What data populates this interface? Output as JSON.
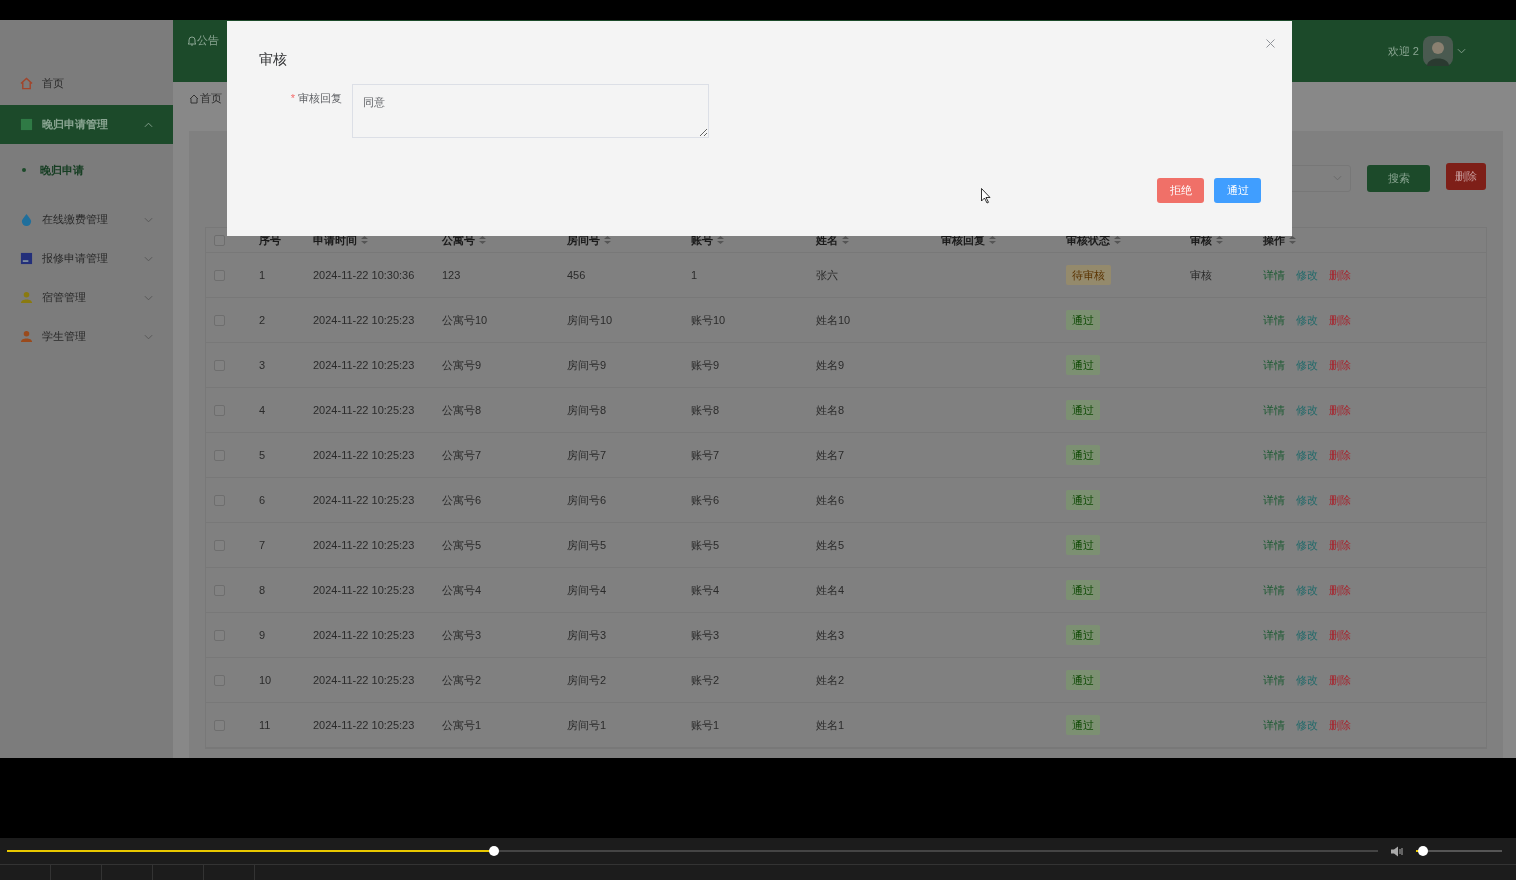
{
  "header": {
    "notice": "公告",
    "welcome": "欢迎 2"
  },
  "sidebar": {
    "items": [
      {
        "label": "首页",
        "kind": "link",
        "selected": false
      },
      {
        "label": "晚归申请管理",
        "kind": "menu",
        "selected": true,
        "expanded": true,
        "children": [
          {
            "label": "晚归申请",
            "selected": true
          }
        ]
      },
      {
        "label": "在线缴费管理",
        "kind": "menu",
        "selected": false,
        "expanded": false
      },
      {
        "label": "报修申请管理",
        "kind": "menu",
        "selected": false,
        "expanded": false
      },
      {
        "label": "宿管管理",
        "kind": "menu",
        "selected": false,
        "expanded": false
      },
      {
        "label": "学生管理",
        "kind": "menu",
        "selected": false,
        "expanded": false
      }
    ]
  },
  "breadcrumb": "首页",
  "toolbar": {
    "search_button": "搜索",
    "delete_button": "删除"
  },
  "table": {
    "all_checked": false,
    "columns": [
      "序号",
      "申请时间",
      "公寓号",
      "房间号",
      "账号",
      "姓名",
      "审核回复",
      "审核状态",
      "审核",
      "操作"
    ],
    "rows": [
      {
        "checked": false,
        "cells": [
          "1",
          "2024-11-22 10:30:36",
          "123",
          "456",
          "1",
          "张六"
        ],
        "status": {
          "label": "待审核",
          "kind": "pending"
        },
        "audit": "审核",
        "actions": [
          {
            "label": "详情",
            "kind": "detail"
          },
          {
            "label": "修改",
            "kind": "edit"
          },
          {
            "label": "删除",
            "kind": "delete"
          }
        ]
      },
      {
        "checked": false,
        "cells": [
          "2",
          "2024-11-22 10:25:23",
          "公寓号10",
          "房间号10",
          "账号10",
          "姓名10"
        ],
        "status": {
          "label": "通过",
          "kind": "passed"
        },
        "actions": [
          {
            "label": "详情",
            "kind": "detail"
          },
          {
            "label": "修改",
            "kind": "edit"
          },
          {
            "label": "删除",
            "kind": "delete"
          }
        ]
      },
      {
        "checked": false,
        "cells": [
          "3",
          "2024-11-22 10:25:23",
          "公寓号9",
          "房间号9",
          "账号9",
          "姓名9"
        ],
        "status": {
          "label": "通过",
          "kind": "passed"
        },
        "actions": [
          {
            "label": "详情",
            "kind": "detail"
          },
          {
            "label": "修改",
            "kind": "edit"
          },
          {
            "label": "删除",
            "kind": "delete"
          }
        ]
      },
      {
        "checked": false,
        "cells": [
          "4",
          "2024-11-22 10:25:23",
          "公寓号8",
          "房间号8",
          "账号8",
          "姓名8"
        ],
        "status": {
          "label": "通过",
          "kind": "passed"
        },
        "actions": [
          {
            "label": "详情",
            "kind": "detail"
          },
          {
            "label": "修改",
            "kind": "edit"
          },
          {
            "label": "删除",
            "kind": "delete"
          }
        ]
      },
      {
        "checked": false,
        "cells": [
          "5",
          "2024-11-22 10:25:23",
          "公寓号7",
          "房间号7",
          "账号7",
          "姓名7"
        ],
        "status": {
          "label": "通过",
          "kind": "passed"
        },
        "actions": [
          {
            "label": "详情",
            "kind": "detail"
          },
          {
            "label": "修改",
            "kind": "edit"
          },
          {
            "label": "删除",
            "kind": "delete"
          }
        ]
      },
      {
        "checked": false,
        "cells": [
          "6",
          "2024-11-22 10:25:23",
          "公寓号6",
          "房间号6",
          "账号6",
          "姓名6"
        ],
        "status": {
          "label": "通过",
          "kind": "passed"
        },
        "actions": [
          {
            "label": "详情",
            "kind": "detail"
          },
          {
            "label": "修改",
            "kind": "edit"
          },
          {
            "label": "删除",
            "kind": "delete"
          }
        ]
      },
      {
        "checked": false,
        "cells": [
          "7",
          "2024-11-22 10:25:23",
          "公寓号5",
          "房间号5",
          "账号5",
          "姓名5"
        ],
        "status": {
          "label": "通过",
          "kind": "passed"
        },
        "actions": [
          {
            "label": "详情",
            "kind": "detail"
          },
          {
            "label": "修改",
            "kind": "edit"
          },
          {
            "label": "删除",
            "kind": "delete"
          }
        ]
      },
      {
        "checked": false,
        "cells": [
          "8",
          "2024-11-22 10:25:23",
          "公寓号4",
          "房间号4",
          "账号4",
          "姓名4"
        ],
        "status": {
          "label": "通过",
          "kind": "passed"
        },
        "actions": [
          {
            "label": "详情",
            "kind": "detail"
          },
          {
            "label": "修改",
            "kind": "edit"
          },
          {
            "label": "删除",
            "kind": "delete"
          }
        ]
      },
      {
        "checked": false,
        "cells": [
          "9",
          "2024-11-22 10:25:23",
          "公寓号3",
          "房间号3",
          "账号3",
          "姓名3"
        ],
        "status": {
          "label": "通过",
          "kind": "passed"
        },
        "actions": [
          {
            "label": "详情",
            "kind": "detail"
          },
          {
            "label": "修改",
            "kind": "edit"
          },
          {
            "label": "删除",
            "kind": "delete"
          }
        ]
      },
      {
        "checked": false,
        "cells": [
          "10",
          "2024-11-22 10:25:23",
          "公寓号2",
          "房间号2",
          "账号2",
          "姓名2"
        ],
        "status": {
          "label": "通过",
          "kind": "passed"
        },
        "actions": [
          {
            "label": "详情",
            "kind": "detail"
          },
          {
            "label": "修改",
            "kind": "edit"
          },
          {
            "label": "删除",
            "kind": "delete"
          }
        ]
      },
      {
        "checked": false,
        "cells": [
          "11",
          "2024-11-22 10:25:23",
          "公寓号1",
          "房间号1",
          "账号1",
          "姓名1"
        ],
        "status": {
          "label": "通过",
          "kind": "passed"
        },
        "actions": [
          {
            "label": "详情",
            "kind": "detail"
          },
          {
            "label": "修改",
            "kind": "edit"
          },
          {
            "label": "删除",
            "kind": "delete"
          }
        ]
      }
    ]
  },
  "dialog": {
    "title": "审核",
    "field": {
      "label": "审核回复",
      "required_mark": "*",
      "value": "同意"
    },
    "buttons": [
      {
        "label": "拒绝",
        "kind": "danger"
      },
      {
        "label": "通过",
        "kind": "primary"
      }
    ]
  },
  "player": {
    "progress": {
      "level": 0.355
    },
    "volume": {
      "level": 0.08
    }
  }
}
